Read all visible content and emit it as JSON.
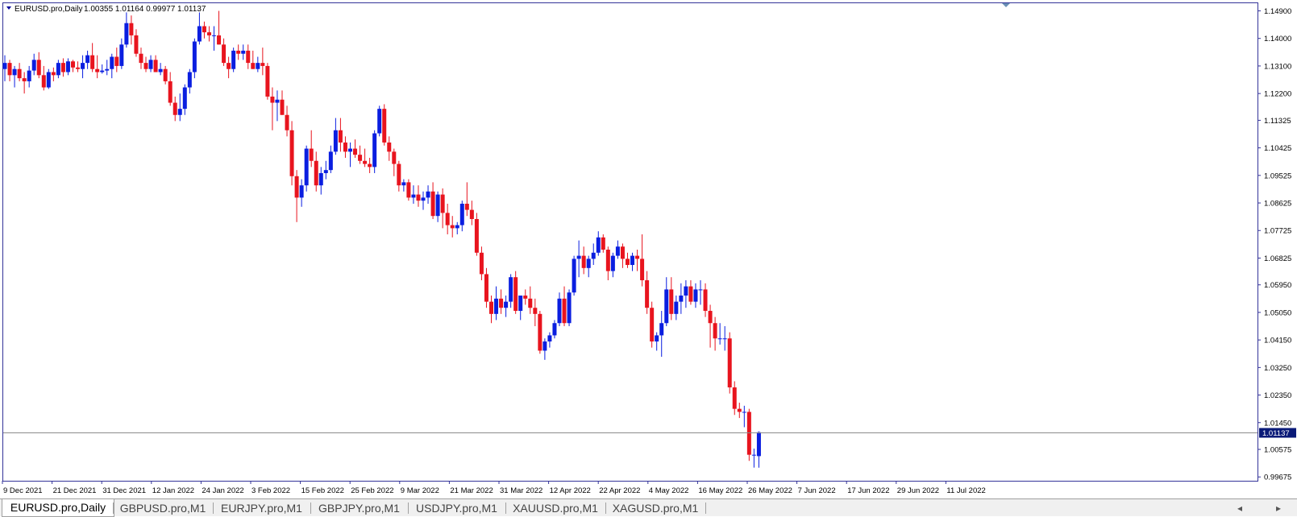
{
  "window": {
    "symbol_title": "EURUSD.pro,Daily",
    "ohlc_text": "1.00355 1.01164 0.99977 1.01137",
    "collapse_icon": "triangle-down-icon"
  },
  "colors": {
    "bull": "#0a1ee0",
    "bear": "#e8141e",
    "axis": "#333399",
    "price_line": "#8c8c8c",
    "price_label_bg": "#0a1a78"
  },
  "tabs": [
    {
      "label": "EURUSD.pro,Daily",
      "active": true
    },
    {
      "label": "GBPUSD.pro,M1",
      "active": false
    },
    {
      "label": "EURJPY.pro,M1",
      "active": false
    },
    {
      "label": "GBPJPY.pro,M1",
      "active": false
    },
    {
      "label": "USDJPY.pro,M1",
      "active": false
    },
    {
      "label": "XAUUSD.pro,M1",
      "active": false
    },
    {
      "label": "XAGUSD.pro,M1",
      "active": false
    }
  ],
  "chart_data": {
    "type": "candlestick",
    "symbol": "EURUSD.pro",
    "timeframe": "Daily",
    "current_price": "1.01137",
    "y_ticks": [
      "1.14900",
      "1.14000",
      "1.13100",
      "1.12200",
      "1.11325",
      "1.10425",
      "1.09525",
      "1.08625",
      "1.07725",
      "1.06825",
      "1.05950",
      "1.05050",
      "1.04150",
      "1.03250",
      "1.02350",
      "1.01450",
      "1.00575",
      "0.99675"
    ],
    "x_ticks": [
      "9 Dec 2021",
      "21 Dec 2021",
      "31 Dec 2021",
      "12 Jan 2022",
      "24 Jan 2022",
      "3 Feb 2022",
      "15 Feb 2022",
      "25 Feb 2022",
      "9 Mar 2022",
      "21 Mar 2022",
      "31 Mar 2022",
      "12 Apr 2022",
      "22 Apr 2022",
      "4 May 2022",
      "16 May 2022",
      "26 May 2022",
      "7 Jun 2022",
      "17 Jun 2022",
      "29 Jun 2022",
      "11 Jul 2022"
    ],
    "ylim": [
      0.9955,
      1.1515
    ],
    "grid": false,
    "candles": [
      [
        1.13,
        1.1345,
        1.126,
        1.132
      ],
      [
        1.132,
        1.133,
        1.126,
        1.128
      ],
      [
        1.128,
        1.131,
        1.124,
        1.13
      ],
      [
        1.13,
        1.132,
        1.126,
        1.127
      ],
      [
        1.127,
        1.129,
        1.122,
        1.126
      ],
      [
        1.126,
        1.131,
        1.124,
        1.1295
      ],
      [
        1.1295,
        1.135,
        1.128,
        1.133
      ],
      [
        1.133,
        1.1355,
        1.127,
        1.128
      ],
      [
        1.128,
        1.131,
        1.123,
        1.124
      ],
      [
        1.124,
        1.13,
        1.1235,
        1.129
      ],
      [
        1.129,
        1.1305,
        1.126,
        1.128
      ],
      [
        1.128,
        1.133,
        1.127,
        1.132
      ],
      [
        1.132,
        1.1335,
        1.1275,
        1.129
      ],
      [
        1.129,
        1.1335,
        1.128,
        1.1325
      ],
      [
        1.1325,
        1.133,
        1.129,
        1.1305
      ],
      [
        1.1305,
        1.1325,
        1.129,
        1.13
      ],
      [
        1.13,
        1.1345,
        1.127,
        1.132
      ],
      [
        1.132,
        1.136,
        1.13,
        1.1345
      ],
      [
        1.1345,
        1.1385,
        1.129,
        1.13
      ],
      [
        1.13,
        1.1345,
        1.127,
        1.129
      ],
      [
        1.129,
        1.1315,
        1.1285,
        1.1295
      ],
      [
        1.1295,
        1.133,
        1.128,
        1.13
      ],
      [
        1.13,
        1.135,
        1.127,
        1.134
      ],
      [
        1.134,
        1.137,
        1.129,
        1.131
      ],
      [
        1.131,
        1.14,
        1.13,
        1.138
      ],
      [
        1.138,
        1.1485,
        1.137,
        1.145
      ],
      [
        1.145,
        1.1475,
        1.138,
        1.141
      ],
      [
        1.141,
        1.143,
        1.134,
        1.135
      ],
      [
        1.135,
        1.137,
        1.13,
        1.132
      ],
      [
        1.132,
        1.134,
        1.129,
        1.13
      ],
      [
        1.13,
        1.1345,
        1.129,
        1.133
      ],
      [
        1.133,
        1.1345,
        1.129,
        1.129
      ],
      [
        1.129,
        1.132,
        1.128,
        1.13
      ],
      [
        1.13,
        1.131,
        1.125,
        1.126
      ],
      [
        1.126,
        1.129,
        1.118,
        1.119
      ],
      [
        1.119,
        1.121,
        1.113,
        1.115
      ],
      [
        1.115,
        1.122,
        1.113,
        1.117
      ],
      [
        1.117,
        1.125,
        1.115,
        1.124
      ],
      [
        1.124,
        1.13,
        1.122,
        1.129
      ],
      [
        1.129,
        1.14,
        1.127,
        1.139
      ],
      [
        1.139,
        1.1485,
        1.138,
        1.144
      ],
      [
        1.144,
        1.1455,
        1.14,
        1.142
      ],
      [
        1.142,
        1.144,
        1.139,
        1.141
      ],
      [
        1.141,
        1.144,
        1.136,
        1.141
      ],
      [
        1.141,
        1.149,
        1.138,
        1.138
      ],
      [
        1.138,
        1.14,
        1.131,
        1.132
      ],
      [
        1.132,
        1.134,
        1.127,
        1.13
      ],
      [
        1.13,
        1.137,
        1.129,
        1.136
      ],
      [
        1.136,
        1.138,
        1.133,
        1.135
      ],
      [
        1.135,
        1.138,
        1.133,
        1.136
      ],
      [
        1.136,
        1.138,
        1.13,
        1.132
      ],
      [
        1.132,
        1.136,
        1.13,
        1.13
      ],
      [
        1.13,
        1.134,
        1.129,
        1.132
      ],
      [
        1.132,
        1.137,
        1.128,
        1.131
      ],
      [
        1.131,
        1.132,
        1.12,
        1.121
      ],
      [
        1.121,
        1.124,
        1.11,
        1.119
      ],
      [
        1.119,
        1.123,
        1.113,
        1.12
      ],
      [
        1.12,
        1.123,
        1.115,
        1.115
      ],
      [
        1.115,
        1.118,
        1.108,
        1.11
      ],
      [
        1.11,
        1.113,
        1.092,
        1.095
      ],
      [
        1.095,
        1.097,
        1.08,
        1.088
      ],
      [
        1.088,
        1.094,
        1.085,
        1.092
      ],
      [
        1.092,
        1.105,
        1.09,
        1.104
      ],
      [
        1.104,
        1.11,
        1.098,
        1.1
      ],
      [
        1.1,
        1.103,
        1.09,
        1.092
      ],
      [
        1.092,
        1.098,
        1.089,
        1.096
      ],
      [
        1.096,
        1.1,
        1.094,
        1.097
      ],
      [
        1.097,
        1.105,
        1.096,
        1.103
      ],
      [
        1.103,
        1.114,
        1.102,
        1.11
      ],
      [
        1.11,
        1.114,
        1.103,
        1.106
      ],
      [
        1.106,
        1.108,
        1.101,
        1.103
      ],
      [
        1.103,
        1.106,
        1.098,
        1.104
      ],
      [
        1.104,
        1.107,
        1.101,
        1.102
      ],
      [
        1.102,
        1.105,
        1.099,
        1.1
      ],
      [
        1.1,
        1.104,
        1.098,
        1.099
      ],
      [
        1.099,
        1.101,
        1.096,
        1.098
      ],
      [
        1.098,
        1.11,
        1.096,
        1.109
      ],
      [
        1.109,
        1.118,
        1.108,
        1.117
      ],
      [
        1.117,
        1.1185,
        1.105,
        1.106
      ],
      [
        1.106,
        1.108,
        1.1,
        1.103
      ],
      [
        1.103,
        1.104,
        1.095,
        1.099
      ],
      [
        1.099,
        1.1,
        1.09,
        1.092
      ],
      [
        1.092,
        1.094,
        1.09,
        1.093
      ],
      [
        1.093,
        1.094,
        1.087,
        1.088
      ],
      [
        1.088,
        1.092,
        1.086,
        1.089
      ],
      [
        1.089,
        1.092,
        1.085,
        1.087
      ],
      [
        1.087,
        1.09,
        1.084,
        1.088
      ],
      [
        1.088,
        1.092,
        1.086,
        1.09
      ],
      [
        1.09,
        1.093,
        1.081,
        1.082
      ],
      [
        1.082,
        1.09,
        1.08,
        1.089
      ],
      [
        1.089,
        1.091,
        1.078,
        1.083
      ],
      [
        1.083,
        1.086,
        1.076,
        1.079
      ],
      [
        1.079,
        1.082,
        1.075,
        1.078
      ],
      [
        1.078,
        1.08,
        1.076,
        1.079
      ],
      [
        1.079,
        1.087,
        1.077,
        1.086
      ],
      [
        1.086,
        1.093,
        1.082,
        1.084
      ],
      [
        1.084,
        1.087,
        1.079,
        1.081
      ],
      [
        1.081,
        1.083,
        1.069,
        1.07
      ],
      [
        1.07,
        1.072,
        1.061,
        1.063
      ],
      [
        1.063,
        1.065,
        1.052,
        1.054
      ],
      [
        1.054,
        1.056,
        1.047,
        1.05
      ],
      [
        1.05,
        1.059,
        1.048,
        1.055
      ],
      [
        1.055,
        1.058,
        1.05,
        1.052
      ],
      [
        1.052,
        1.056,
        1.049,
        1.054
      ],
      [
        1.054,
        1.063,
        1.052,
        1.062
      ],
      [
        1.062,
        1.064,
        1.05,
        1.051
      ],
      [
        1.051,
        1.056,
        1.048,
        1.056
      ],
      [
        1.056,
        1.058,
        1.053,
        1.055
      ],
      [
        1.055,
        1.059,
        1.05,
        1.052
      ],
      [
        1.052,
        1.055,
        1.046,
        1.05
      ],
      [
        1.05,
        1.051,
        1.037,
        1.038
      ],
      [
        1.038,
        1.042,
        1.035,
        1.041
      ],
      [
        1.041,
        1.044,
        1.039,
        1.043
      ],
      [
        1.043,
        1.048,
        1.042,
        1.047
      ],
      [
        1.047,
        1.057,
        1.046,
        1.055
      ],
      [
        1.055,
        1.059,
        1.046,
        1.047
      ],
      [
        1.047,
        1.058,
        1.046,
        1.057
      ],
      [
        1.057,
        1.069,
        1.056,
        1.068
      ],
      [
        1.068,
        1.074,
        1.062,
        1.069
      ],
      [
        1.069,
        1.072,
        1.063,
        1.065
      ],
      [
        1.065,
        1.069,
        1.062,
        1.068
      ],
      [
        1.068,
        1.073,
        1.066,
        1.07
      ],
      [
        1.07,
        1.077,
        1.069,
        1.075
      ],
      [
        1.075,
        1.076,
        1.07,
        1.071
      ],
      [
        1.071,
        1.072,
        1.061,
        1.064
      ],
      [
        1.064,
        1.07,
        1.062,
        1.069
      ],
      [
        1.069,
        1.074,
        1.068,
        1.072
      ],
      [
        1.072,
        1.073,
        1.065,
        1.068
      ],
      [
        1.068,
        1.07,
        1.065,
        1.066
      ],
      [
        1.066,
        1.07,
        1.064,
        1.069
      ],
      [
        1.069,
        1.071,
        1.064,
        1.068
      ],
      [
        1.068,
        1.076,
        1.059,
        1.061
      ],
      [
        1.061,
        1.064,
        1.05,
        1.052
      ],
      [
        1.052,
        1.054,
        1.039,
        1.041
      ],
      [
        1.041,
        1.044,
        1.038,
        1.043
      ],
      [
        1.043,
        1.051,
        1.036,
        1.047
      ],
      [
        1.047,
        1.062,
        1.046,
        1.058
      ],
      [
        1.058,
        1.062,
        1.048,
        1.05
      ],
      [
        1.05,
        1.056,
        1.048,
        1.054
      ],
      [
        1.054,
        1.06,
        1.05,
        1.056
      ],
      [
        1.056,
        1.061,
        1.052,
        1.059
      ],
      [
        1.059,
        1.061,
        1.053,
        1.054
      ],
      [
        1.054,
        1.06,
        1.052,
        1.058
      ],
      [
        1.058,
        1.061,
        1.053,
        1.058
      ],
      [
        1.058,
        1.06,
        1.049,
        1.051
      ],
      [
        1.051,
        1.053,
        1.039,
        1.047
      ],
      [
        1.047,
        1.049,
        1.038,
        1.042
      ],
      [
        1.042,
        1.047,
        1.04,
        1.042
      ],
      [
        1.042,
        1.046,
        1.038,
        1.042
      ],
      [
        1.042,
        1.044,
        1.024,
        1.026
      ],
      [
        1.026,
        1.028,
        1.017,
        1.019
      ],
      [
        1.019,
        1.021,
        1.016,
        1.018
      ],
      [
        1.018,
        1.02,
        1.013,
        1.018
      ],
      [
        1.018,
        1.019,
        1.002,
        1.004
      ],
      [
        1.004,
        1.006,
        0.9998,
        1.004
      ],
      [
        1.00355,
        1.01164,
        0.99977,
        1.01137
      ]
    ]
  }
}
